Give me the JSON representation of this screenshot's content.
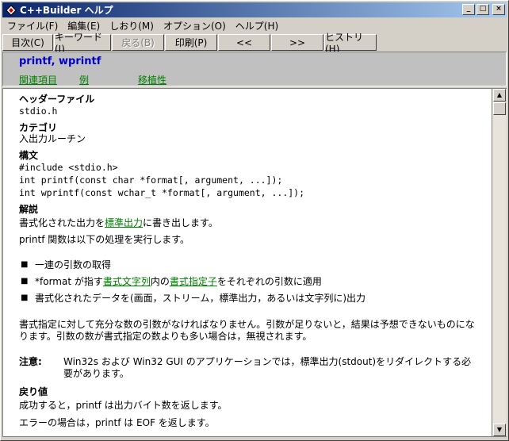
{
  "window": {
    "title": "C++Builder ヘルプ"
  },
  "title_buttons": {
    "minimize": "_",
    "maximize": "□",
    "close": "×"
  },
  "menu": [
    "ファイル(F)",
    "編集(E)",
    "しおり(M)",
    "オプション(O)",
    "ヘルプ(H)"
  ],
  "toolbar": {
    "contents": "目次(C)",
    "keyword": "キーワード(I)",
    "back": "戻る(B)",
    "print": "印刷(P)",
    "prev": "<<",
    "next": ">>",
    "history": "ヒストリ(H)"
  },
  "topic": {
    "title": "printf, wprintf",
    "links": [
      "関連項目",
      "例",
      "移植性"
    ]
  },
  "content": {
    "header_file_heading": "ヘッダーファイル",
    "header_file": "stdio.h",
    "category_heading": "カテゴリ",
    "category": "入出力ルーチン",
    "syntax_heading": "構文",
    "syntax": [
      "#include <stdio.h>",
      "int printf(const char *format[, argument, ...]);",
      "int wprintf(const wchar_t *format[, argument, ...]);"
    ],
    "desc_heading": "解説",
    "desc1_pre": "書式化された出力を",
    "desc1_link": "標準出力",
    "desc1_post": "に書き出します。",
    "desc2": "printf 関数は以下の処理を実行します。",
    "bullet1": "一連の引数の取得",
    "bullet2_pre": "*format が指す",
    "bullet2_link1": "書式文字列",
    "bullet2_mid": "内の",
    "bullet2_link2": "書式指定子",
    "bullet2_post": "をそれぞれの引数に適用",
    "bullet3": "書式化されたデータを(画面，ストリーム，標準出力，あるいは文字列に)出力",
    "para": "書式指定に対して充分な数の引数がなければなりません。引数が足りないと，結果は予想できないものになります。引数の数が書式指定の数よりも多い場合は，無視されます。",
    "note_label": "注意:",
    "note_text": "Win32s および Win32 GUI のアプリケーションでは，標準出力(stdout)をリダイレクトする必要があります。",
    "return_heading": "戻り値",
    "return1": "成功すると，printf は出力バイト数を返します。",
    "return2": "エラーの場合は，printf は EOF を返します。"
  }
}
